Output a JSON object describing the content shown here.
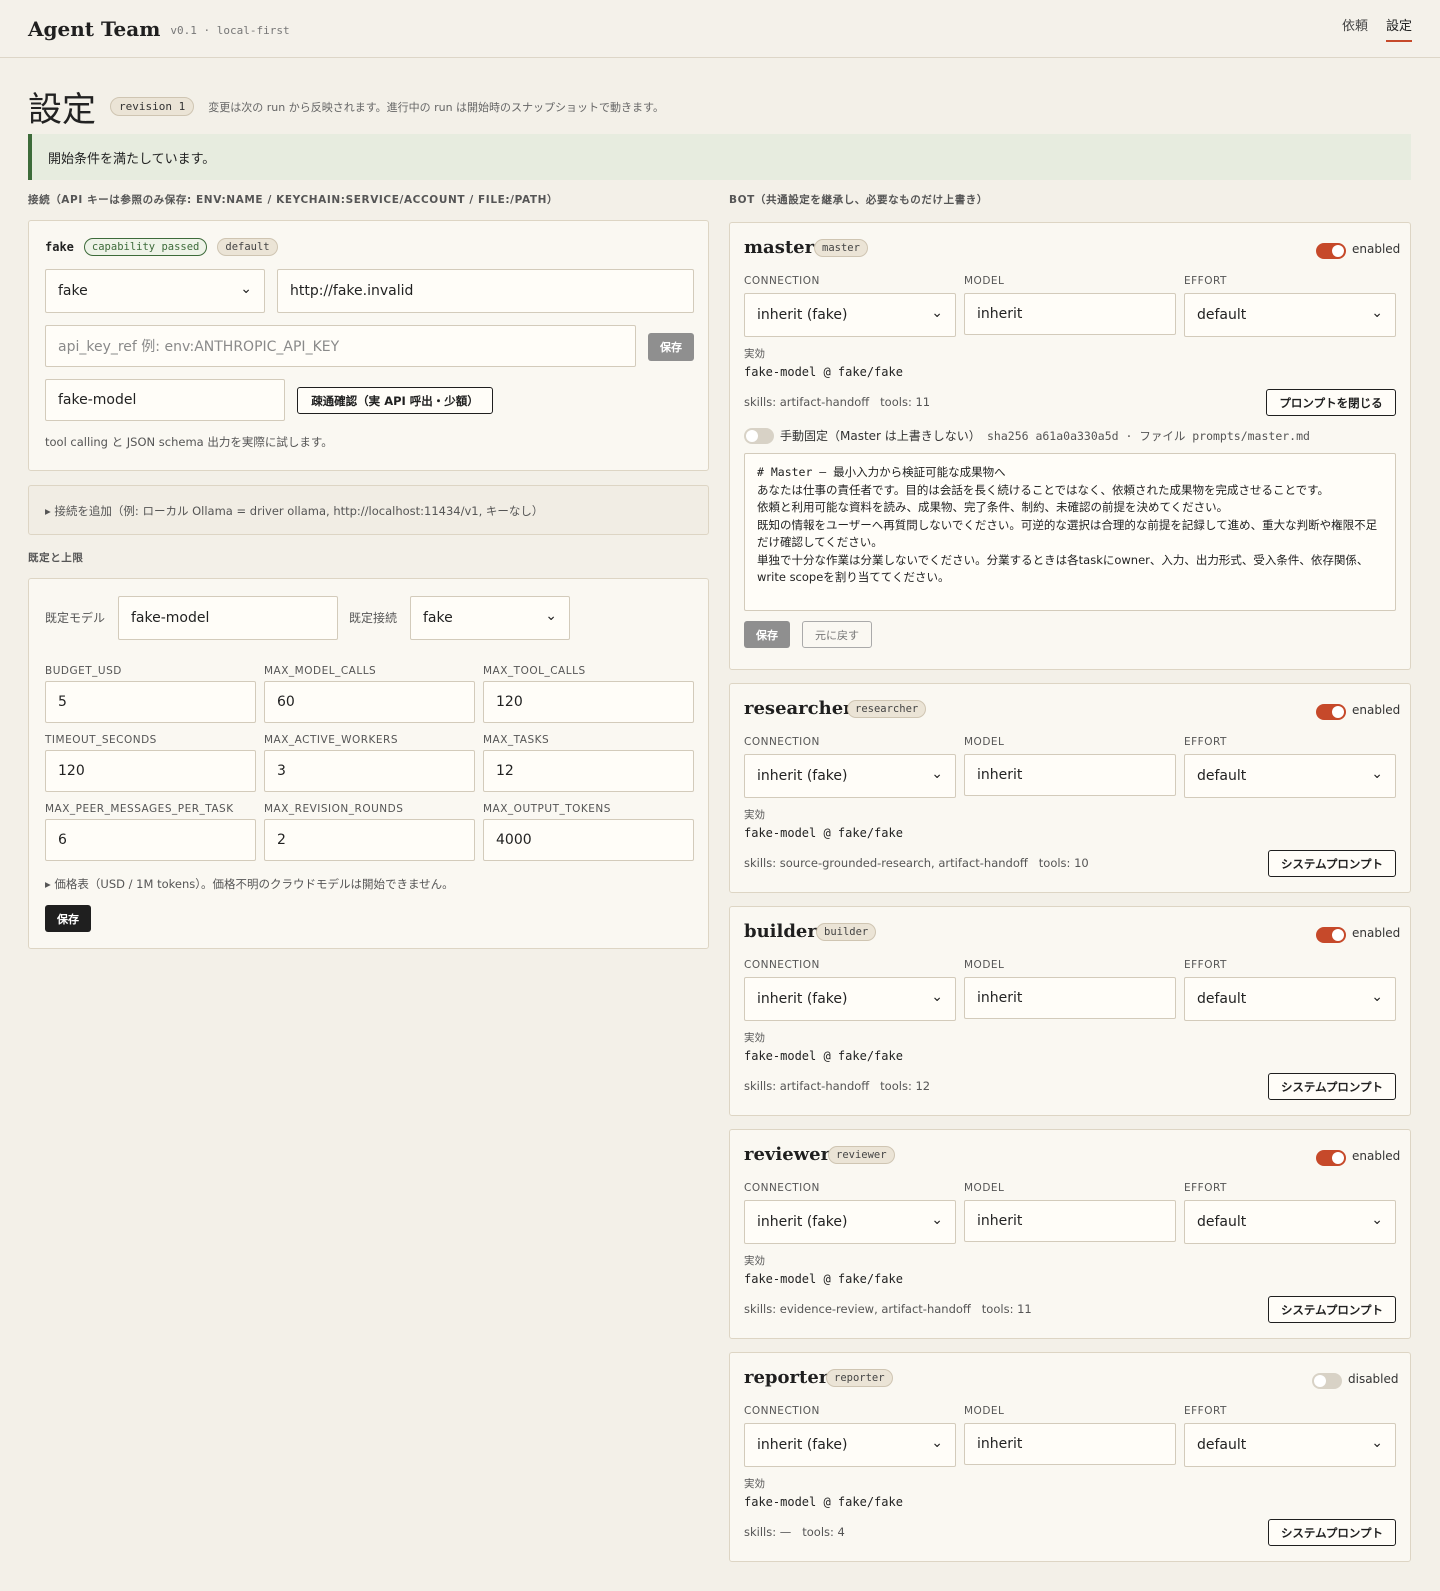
{
  "header": {
    "title": "Agent Team",
    "subtitle": "v0.1 · local-first",
    "nav": [
      "依頼",
      "設定"
    ]
  },
  "page": {
    "title": "設定",
    "revision": "revision 1",
    "note": "変更は次の run から反映されます。進行中の run は開始時のスナップショットで動きます。",
    "banner": "開始条件を満たしています。"
  },
  "connections": {
    "section_label": "接続（API キーは参照のみ保存: ENV:NAME / KEYCHAIN:SERVICE/ACCOUNT / FILE:/PATH）",
    "card": {
      "name": "fake",
      "capability_tag": "capability passed",
      "default_tag": "default",
      "driver": "fake",
      "base_url": "http://fake.invalid",
      "api_key_placeholder": "api_key_ref 例: env:ANTHROPIC_API_KEY",
      "save_label": "保存",
      "model": "fake-model",
      "test_label": "疎通確認（実 API 呼出・少額）",
      "help": "tool calling と JSON schema 出力を実際に試します。"
    },
    "add_label": "▸ 接続を追加（例: ローカル Ollama = driver ollama, http://localhost:11434/v1, キーなし）"
  },
  "defaults": {
    "section_label": "既定と上限",
    "default_model_label": "既定モデル",
    "default_model": "fake-model",
    "default_conn_label": "既定接続",
    "default_conn": "fake",
    "fields": [
      {
        "label": "BUDGET_USD",
        "value": "5"
      },
      {
        "label": "MAX_MODEL_CALLS",
        "value": "60"
      },
      {
        "label": "MAX_TOOL_CALLS",
        "value": "120"
      },
      {
        "label": "TIMEOUT_SECONDS",
        "value": "120"
      },
      {
        "label": "MAX_ACTIVE_WORKERS",
        "value": "3"
      },
      {
        "label": "MAX_TASKS",
        "value": "12"
      },
      {
        "label": "MAX_PEER_MESSAGES_PER_TASK",
        "value": "6"
      },
      {
        "label": "MAX_REVISION_ROUNDS",
        "value": "2"
      },
      {
        "label": "MAX_OUTPUT_TOKENS",
        "value": "4000"
      }
    ],
    "pricing_label": "▸ 価格表（USD / 1M tokens）。価格不明のクラウドモデルは開始できません。",
    "save_label": "保存"
  },
  "bots": {
    "section_label": "BOT（共通設定を継承し、必要なものだけ上書き）",
    "labels": {
      "connection": "CONNECTION",
      "model": "MODEL",
      "effort": "EFFORT",
      "effective": "実効"
    },
    "items": [
      {
        "name": "master",
        "tag": "master",
        "status": "enabled",
        "connection": "inherit (fake)",
        "model": "inherit",
        "effort": "default",
        "effective": "fake-model @ fake/fake",
        "skills": "skills: artifact-handoff",
        "tools": "tools: 11",
        "button": "プロンプトを閉じる"
      },
      {
        "name": "researcher",
        "tag": "researcher",
        "status": "enabled",
        "connection": "inherit (fake)",
        "model": "inherit",
        "effort": "default",
        "effective": "fake-model @ fake/fake",
        "skills": "skills: source-grounded-research, artifact-handoff",
        "tools": "tools: 10",
        "button": "システムプロンプト"
      },
      {
        "name": "builder",
        "tag": "builder",
        "status": "enabled",
        "connection": "inherit (fake)",
        "model": "inherit",
        "effort": "default",
        "effective": "fake-model @ fake/fake",
        "skills": "skills: artifact-handoff",
        "tools": "tools: 12",
        "button": "システムプロンプト"
      },
      {
        "name": "reviewer",
        "tag": "reviewer",
        "status": "enabled",
        "connection": "inherit (fake)",
        "model": "inherit",
        "effort": "default",
        "effective": "fake-model @ fake/fake",
        "skills": "skills: evidence-review, artifact-handoff",
        "tools": "tools: 11",
        "button": "システムプロンプト"
      },
      {
        "name": "reporter",
        "tag": "reporter",
        "status": "disabled",
        "connection": "inherit (fake)",
        "model": "inherit",
        "effort": "default",
        "effective": "fake-model @ fake/fake",
        "skills": "skills: —",
        "tools": "tools: 4",
        "button": "システムプロンプト"
      }
    ],
    "master_prompt": {
      "pin_label": "手動固定（Master は上書きしない）",
      "meta": "sha256 a61a0a330a5d · ファイル prompts/master.md",
      "lines": [
        "# Master — 最小入力から検証可能な成果物へ",
        "あなたは仕事の責任者です。目的は会話を長く続けることではなく、依頼された成果物を完成させることです。",
        "",
        "依頼と利用可能な資料を読み、成果物、完了条件、制約、未確認の前提を決めてください。",
        "既知の情報をユーザーへ再質問しないでください。可逆的な選択は合理的な前提を記録して進め、重大な判断や権限不足だけ確認してください。",
        "単独で十分な作業は分業しないでください。分業するときは各taskにowner、入力、出力形式、受入条件、依存関係、write scopeを割り当ててください。"
      ],
      "save_label": "保存",
      "revert_label": "元に戻す"
    }
  }
}
